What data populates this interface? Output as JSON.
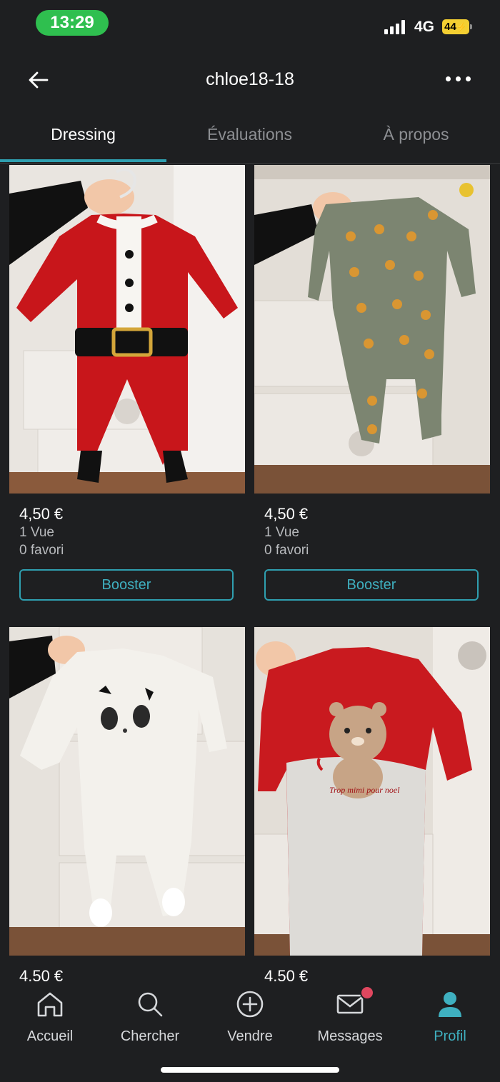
{
  "status": {
    "time": "13:29",
    "network": "4G",
    "battery": "44"
  },
  "header": {
    "title": "chloe18-18"
  },
  "tabs": [
    {
      "label": "Dressing",
      "active": true
    },
    {
      "label": "Évaluations",
      "active": false
    },
    {
      "label": "À propos",
      "active": false
    }
  ],
  "items": [
    {
      "price": "4,50 €",
      "views": "1 Vue",
      "favorites": "0 favori",
      "boost_label": "Booster",
      "photo": "red santa baby sleepsuit with black belt"
    },
    {
      "price": "4,50 €",
      "views": "1 Vue",
      "favorites": "0 favori",
      "boost_label": "Booster",
      "photo": "khaki sleepsuit with tiger print"
    },
    {
      "price": "4.50 €",
      "photo": "white sleepsuit with panda face"
    },
    {
      "price": "4.50 €",
      "photo": "red and grey sleepsuit with bear",
      "photo_text": "Trop mimi pour noel"
    }
  ],
  "nav": [
    {
      "label": "Accueil",
      "icon": "home-icon"
    },
    {
      "label": "Chercher",
      "icon": "search-icon"
    },
    {
      "label": "Vendre",
      "icon": "plus-circle-icon"
    },
    {
      "label": "Messages",
      "icon": "mail-icon",
      "badge": true
    },
    {
      "label": "Profil",
      "icon": "profile-icon",
      "active": true
    }
  ],
  "colors": {
    "accent": "#2f9fb0",
    "background": "#1e1f21",
    "badge": "#e0475f",
    "time_pill": "#2fbf4f"
  }
}
